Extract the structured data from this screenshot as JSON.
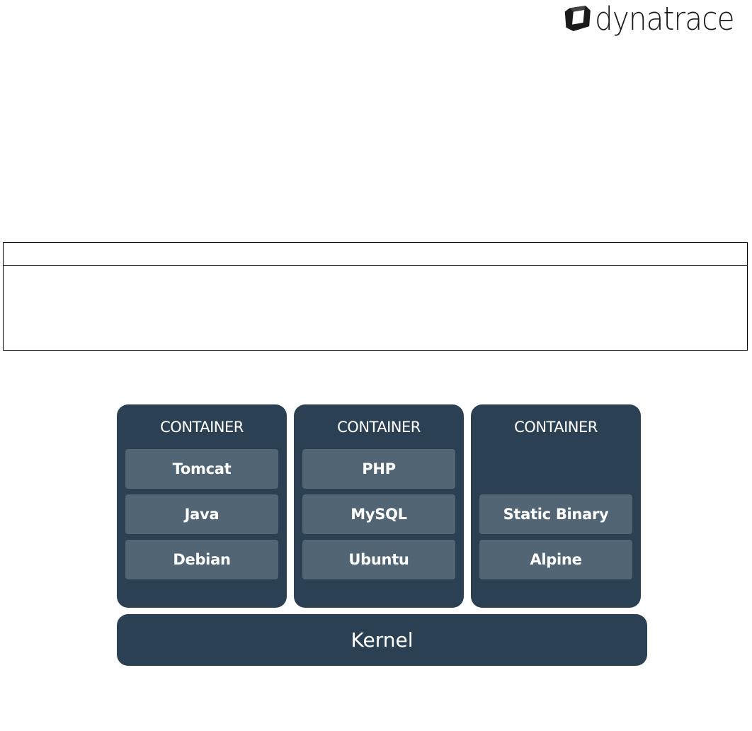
{
  "brand": {
    "name": "dynatrace"
  },
  "diagram": {
    "containers": [
      {
        "title": "CONTAINER",
        "layers": [
          "Tomcat",
          "Java",
          "Debian"
        ]
      },
      {
        "title": "CONTAINER",
        "layers": [
          "PHP",
          "MySQL",
          "Ubuntu"
        ]
      },
      {
        "title": "CONTAINER",
        "layers": [
          "",
          "Static Binary",
          "Alpine"
        ]
      }
    ],
    "base": "Kernel"
  },
  "colors": {
    "container_bg": "#2b4153",
    "layer_bg": "#526574",
    "text": "#ffffff"
  }
}
